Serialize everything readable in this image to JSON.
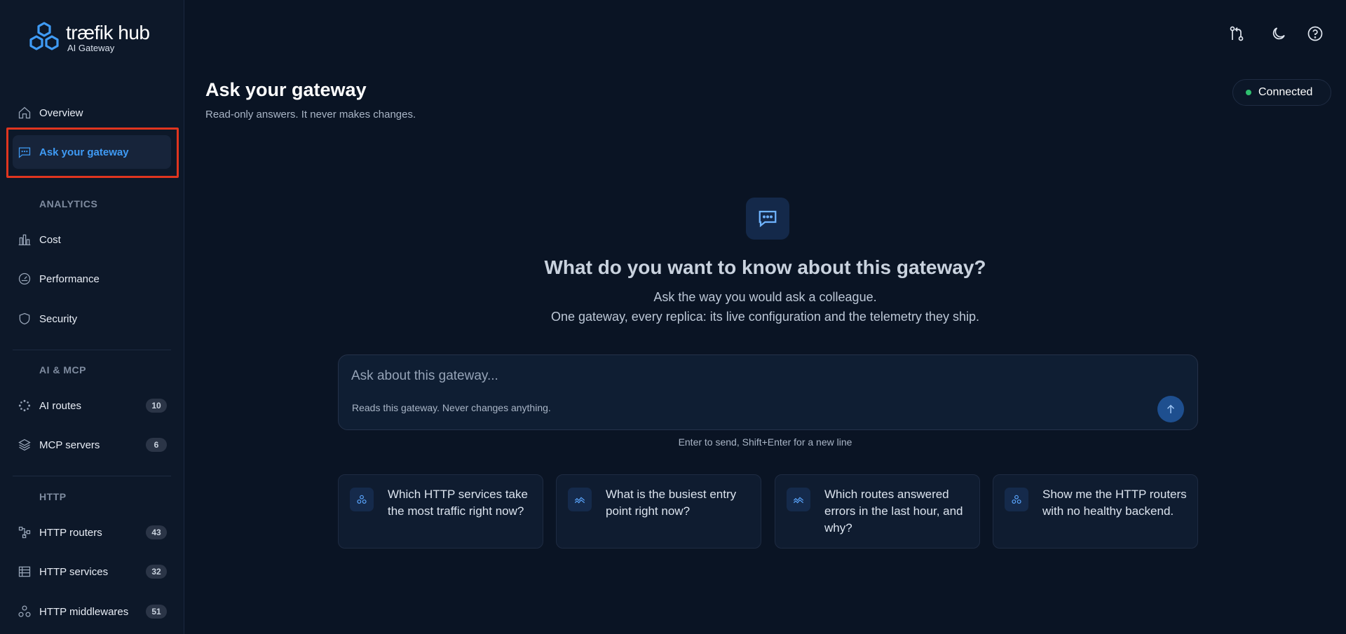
{
  "brand": {
    "name": "træfik hub",
    "subtitle": "AI Gateway"
  },
  "nav": {
    "overview": "Overview",
    "ask": "Ask your gateway",
    "analytics_header": "ANALYTICS",
    "cost": "Cost",
    "performance": "Performance",
    "security": "Security",
    "ai_mcp_header": "AI & MCP",
    "ai_routes": {
      "label": "AI routes",
      "count": "10"
    },
    "mcp_servers": {
      "label": "MCP servers",
      "count": "6"
    },
    "http_header": "HTTP",
    "http_routers": {
      "label": "HTTP routers",
      "count": "43"
    },
    "http_services": {
      "label": "HTTP services",
      "count": "32"
    },
    "http_middlewares": {
      "label": "HTTP middlewares",
      "count": "51"
    }
  },
  "topbar": {
    "icons": [
      "git-compare-icon",
      "moon-icon",
      "help-icon"
    ]
  },
  "header": {
    "title": "Ask your gateway",
    "subtitle": "Read-only answers. It never makes changes.",
    "status": "Connected",
    "status_color": "#2fbf6e"
  },
  "hero": {
    "title": "What do you want to know about this gateway?",
    "line1": "Ask the way you would ask a colleague.",
    "line2": "One gateway, every replica: its live configuration and the telemetry they ship."
  },
  "ask": {
    "placeholder": "Ask about this gateway...",
    "value": "",
    "hint": "Reads this gateway. Never changes anything.",
    "keys_hint": "Enter to send, Shift+Enter for a new line"
  },
  "suggestions": [
    {
      "text": "Which HTTP services take the most traffic right now?",
      "icon": "services-icon"
    },
    {
      "text": "What is the busiest entry point right now?",
      "icon": "activity-icon"
    },
    {
      "text": "Which routes answered errors in the last hour, and why?",
      "icon": "activity-icon"
    },
    {
      "text": "Show me the HTTP routers with no healthy backend.",
      "icon": "services-icon"
    }
  ],
  "colors": {
    "accent": "#3f9bf5",
    "highlight": "#e0351f",
    "background": "#0a1424"
  }
}
